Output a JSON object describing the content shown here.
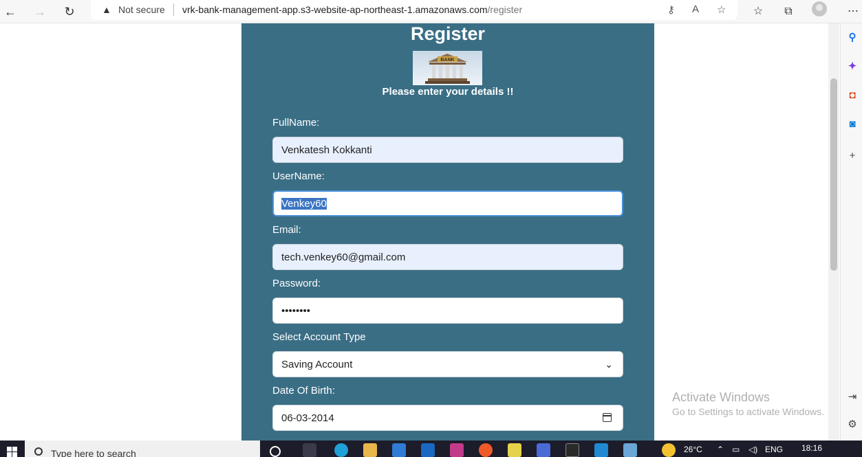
{
  "browser": {
    "security_label": "Not secure",
    "url_host": "vrk-bank-management-app.s3-website-ap-northeast-1.amazonaws.com",
    "url_path": "/register"
  },
  "page": {
    "title": "Register",
    "logo_text": "BANK",
    "subtitle": "Please enter your details !!",
    "fields": {
      "fullname_label": "FullName:",
      "fullname_value": "Venkatesh Kokkanti",
      "username_label": "UserName:",
      "username_value": "Venkey60",
      "email_label": "Email:",
      "email_value": "tech.venkey60@gmail.com",
      "password_label": "Password:",
      "password_value": "••••••••",
      "account_type_label": "Select Account Type",
      "account_type_value": "Saving Account",
      "dob_label": "Date Of Birth:",
      "dob_value": "06-03-2014"
    }
  },
  "watermark": {
    "line1": "Activate Windows",
    "line2": "Go to Settings to activate Windows."
  },
  "taskbar": {
    "search_placeholder": "Type here to search",
    "temperature": "26°C",
    "language": "ENG",
    "time": "18:16"
  },
  "colors": {
    "panel": "#3a6e85",
    "autofill": "#e8f0fe",
    "selection": "#3a75c4"
  }
}
